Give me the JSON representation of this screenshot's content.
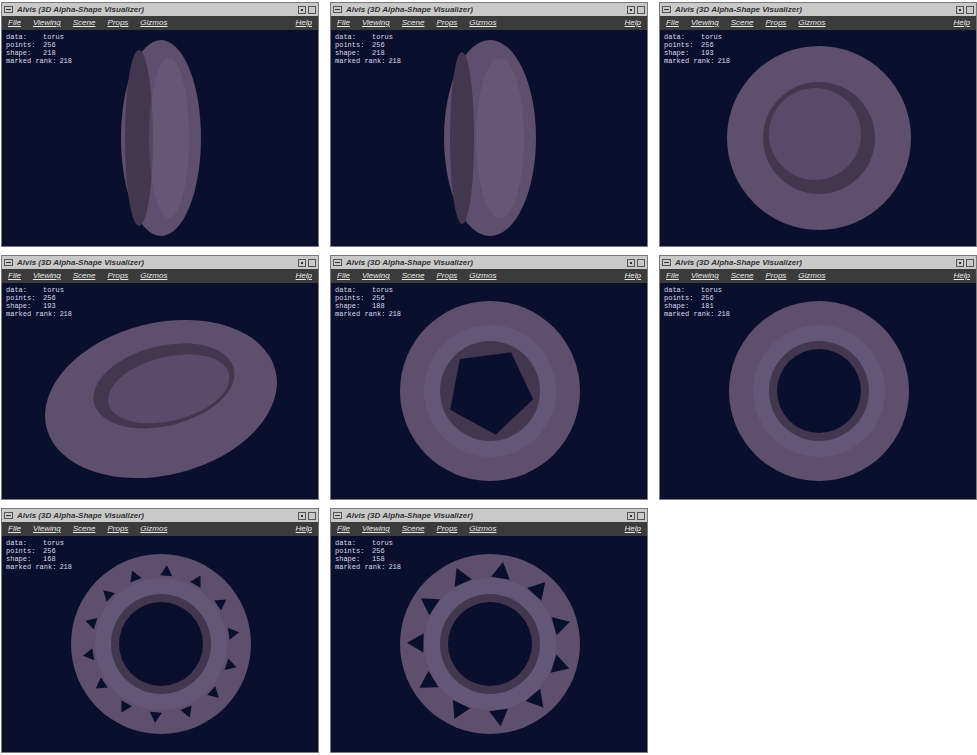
{
  "windows": [
    {
      "title": "Alvis (3D Alpha-Shape Visualizer)",
      "menu": [
        "File",
        "Viewing",
        "Scene",
        "Props",
        "Gizmos"
      ],
      "help": "Help",
      "info": [
        {
          "label": "data:",
          "value": "torus"
        },
        {
          "label": "points:",
          "value": "256"
        },
        {
          "label": "shape:",
          "value": "218"
        },
        {
          "label": "marked rank:",
          "value": "218"
        }
      ],
      "view": {
        "kind": "edge-left"
      }
    },
    {
      "title": "Alvis (3D Alpha-Shape Visualizer)",
      "menu": [
        "File",
        "Viewing",
        "Scene",
        "Props",
        "Gizmos"
      ],
      "help": "Help",
      "info": [
        {
          "label": "data:",
          "value": "torus"
        },
        {
          "label": "points:",
          "value": "256"
        },
        {
          "label": "shape:",
          "value": "218"
        },
        {
          "label": "marked rank:",
          "value": "218"
        }
      ],
      "view": {
        "kind": "edge-right"
      }
    },
    {
      "title": "Alvis (3D Alpha-Shape Visualizer)",
      "menu": [
        "File",
        "Viewing",
        "Scene",
        "Props",
        "Gizmos"
      ],
      "help": "Help",
      "info": [
        {
          "label": "data:",
          "value": "torus"
        },
        {
          "label": "points:",
          "value": "256"
        },
        {
          "label": "shape:",
          "value": "193"
        },
        {
          "label": "marked rank:",
          "value": "218"
        }
      ],
      "view": {
        "kind": "front-filled"
      }
    },
    {
      "title": "Alvis (3D Alpha-Shape Visualizer)",
      "menu": [
        "File",
        "Viewing",
        "Scene",
        "Props",
        "Gizmos"
      ],
      "help": "Help",
      "info": [
        {
          "label": "data:",
          "value": "torus"
        },
        {
          "label": "points:",
          "value": "256"
        },
        {
          "label": "shape:",
          "value": "193"
        },
        {
          "label": "marked rank:",
          "value": "218"
        }
      ],
      "view": {
        "kind": "tilted-filled"
      }
    },
    {
      "title": "Alvis (3D Alpha-Shape Visualizer)",
      "menu": [
        "File",
        "Viewing",
        "Scene",
        "Props",
        "Gizmos"
      ],
      "help": "Help",
      "info": [
        {
          "label": "data:",
          "value": "torus"
        },
        {
          "label": "points:",
          "value": "256"
        },
        {
          "label": "shape:",
          "value": "188"
        },
        {
          "label": "marked rank:",
          "value": "218"
        }
      ],
      "view": {
        "kind": "ring-pentagon-hole"
      }
    },
    {
      "title": "Alvis (3D Alpha-Shape Visualizer)",
      "menu": [
        "File",
        "Viewing",
        "Scene",
        "Props",
        "Gizmos"
      ],
      "help": "Help",
      "info": [
        {
          "label": "data:",
          "value": "torus"
        },
        {
          "label": "points:",
          "value": "256"
        },
        {
          "label": "shape:",
          "value": "181"
        },
        {
          "label": "marked rank:",
          "value": "218"
        }
      ],
      "view": {
        "kind": "ring"
      }
    },
    {
      "title": "Alvis (3D Alpha-Shape Visualizer)",
      "menu": [
        "File",
        "Viewing",
        "Scene",
        "Props",
        "Gizmos"
      ],
      "help": "Help",
      "info": [
        {
          "label": "data:",
          "value": "torus"
        },
        {
          "label": "points:",
          "value": "256"
        },
        {
          "label": "shape:",
          "value": "168"
        },
        {
          "label": "marked rank:",
          "value": "218"
        }
      ],
      "view": {
        "kind": "ring-holes-small"
      }
    },
    {
      "title": "Alvis (3D Alpha-Shape Visualizer)",
      "menu": [
        "File",
        "Viewing",
        "Scene",
        "Props",
        "Gizmos"
      ],
      "help": "Help",
      "info": [
        {
          "label": "data:",
          "value": "torus"
        },
        {
          "label": "points:",
          "value": "256"
        },
        {
          "label": "shape:",
          "value": "158"
        },
        {
          "label": "marked rank:",
          "value": "218"
        }
      ],
      "view": {
        "kind": "ring-holes-large"
      }
    }
  ]
}
